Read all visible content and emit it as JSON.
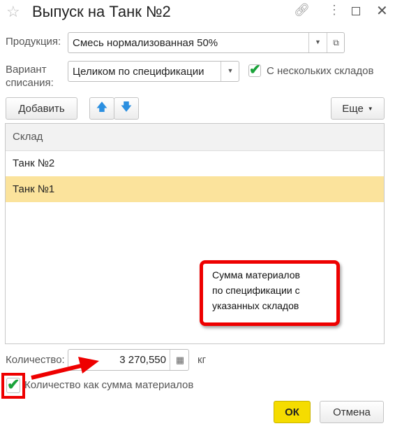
{
  "window": {
    "title": "Выпуск на Танк №2"
  },
  "form": {
    "product_label": "Продукция:",
    "product_value": "Смесь нормализованная 50%",
    "variant_label_1": "Вариант",
    "variant_label_2": "списания:",
    "variant_value": "Целиком по спецификации",
    "multi_stock_label": "С нескольких складов",
    "multi_stock_checked": true
  },
  "toolbar": {
    "add_label": "Добавить",
    "more_label": "Еще"
  },
  "table": {
    "header": "Склад",
    "rows": [
      "Танк №2",
      "Танк №1"
    ],
    "selected_index": 1
  },
  "callout": {
    "lines": [
      "Сумма материалов",
      "по спецификации с",
      "указанных складов"
    ]
  },
  "quantity": {
    "label": "Количество:",
    "value": "3 270,550",
    "unit": "кг",
    "sum_label": "Количество как сумма материалов",
    "sum_checked": true
  },
  "footer": {
    "ok_label": "ОК",
    "cancel_label": "Отмена"
  },
  "colors": {
    "selected_row": "#fbe39c",
    "ok_button": "#f5dc00",
    "annotation": "#ee0000",
    "check": "#1aa33a"
  }
}
